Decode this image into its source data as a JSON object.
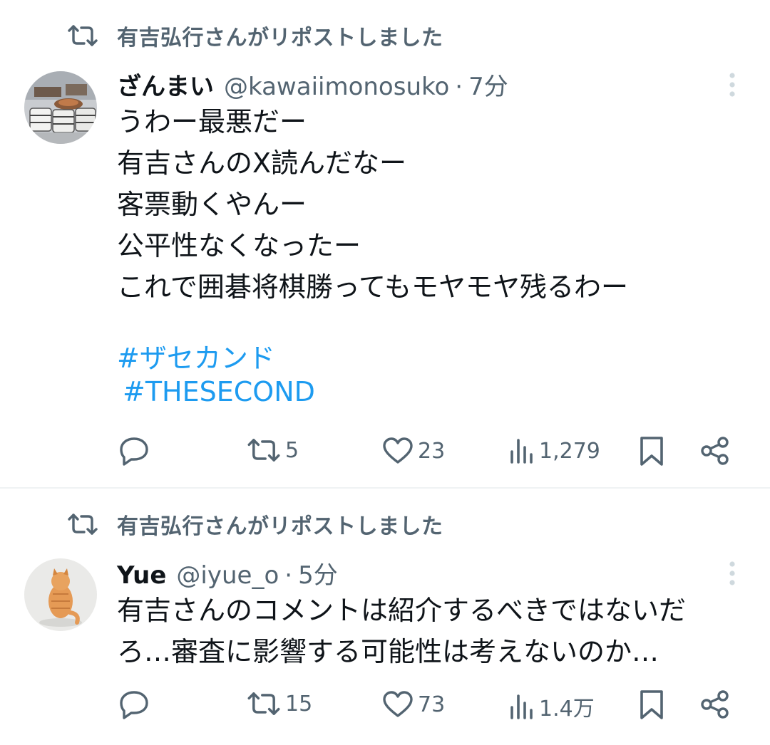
{
  "tweets": [
    {
      "repost_label": "有吉弘行さんがリポストしました",
      "name": "ざんまい",
      "handle": "@kawaiimonosuko",
      "separator": "·",
      "time": "7分",
      "text_lines": [
        "うわー最悪だー",
        "有吉さんのX読んだなー",
        "客票動くやんー",
        "公平性なくなったー",
        "これで囲碁将棋勝ってもモヤモヤ残るわー"
      ],
      "hashtags": [
        "#ザセカンド",
        "#THESECOND"
      ],
      "counts": {
        "replies": "",
        "reposts": "5",
        "likes": "23",
        "views": "1,279"
      }
    },
    {
      "repost_label": "有吉弘行さんがリポストしました",
      "name": "Yue",
      "handle": "@iyue_o",
      "separator": "·",
      "time": "5分",
      "text_lines": [
        "有吉さんのコメントは紹介するべきではないだ",
        "ろ…審査に影響する可能性は考えないのか…"
      ],
      "hashtags": [],
      "counts": {
        "replies": "",
        "reposts": "15",
        "likes": "73",
        "views": "1.4万"
      }
    }
  ],
  "colors": {
    "text": "#0f1419",
    "secondary": "#536471",
    "link": "#1d9bf0",
    "divider": "#eff3f4",
    "background": "#ffffff"
  },
  "icons": [
    "repost-icon",
    "more-icon",
    "reply-icon",
    "like-icon",
    "views-icon",
    "bookmark-icon",
    "share-icon"
  ]
}
